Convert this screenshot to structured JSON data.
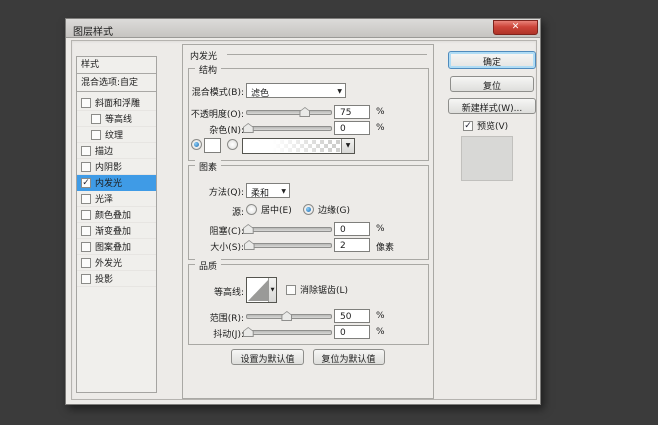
{
  "window": {
    "title": "图层样式",
    "close": "✕"
  },
  "sidebar": {
    "header": "样式",
    "blending": "混合选项:自定",
    "items": [
      {
        "label": "斜面和浮雕",
        "checked": false
      },
      {
        "label": "等高线",
        "checked": false
      },
      {
        "label": "纹理",
        "checked": false
      },
      {
        "label": "描边",
        "checked": false
      },
      {
        "label": "内阴影",
        "checked": false
      },
      {
        "label": "内发光",
        "checked": true,
        "selected": true
      },
      {
        "label": "光泽",
        "checked": false
      },
      {
        "label": "颜色叠加",
        "checked": false
      },
      {
        "label": "渐变叠加",
        "checked": false
      },
      {
        "label": "图案叠加",
        "checked": false
      },
      {
        "label": "外发光",
        "checked": false
      },
      {
        "label": "投影",
        "checked": false
      }
    ]
  },
  "panel": {
    "title": "内发光",
    "structure": {
      "legend": "结构",
      "blend_mode_label": "混合模式(B):",
      "blend_mode_value": "滤色",
      "opacity_label": "不透明度(O):",
      "opacity_value": "75",
      "opacity_unit": "%",
      "noise_label": "杂色(N):",
      "noise_value": "0",
      "noise_unit": "%"
    },
    "elements": {
      "legend": "图素",
      "technique_label": "方法(Q):",
      "technique_value": "柔和",
      "source_label": "源:",
      "source_center": "居中(E)",
      "source_edge": "边缘(G)",
      "choke_label": "阻塞(C):",
      "choke_value": "0",
      "choke_unit": "%",
      "size_label": "大小(S):",
      "size_value": "2",
      "size_unit": "像素"
    },
    "quality": {
      "legend": "品质",
      "contour_label": "等高线:",
      "antialias_label": "消除锯齿(L)",
      "range_label": "范围(R):",
      "range_value": "50",
      "range_unit": "%",
      "jitter_label": "抖动(J):",
      "jitter_value": "0",
      "jitter_unit": "%"
    },
    "footer": {
      "make_default": "设置为默认值",
      "reset_default": "复位为默认值"
    }
  },
  "actions": {
    "ok": "确定",
    "reset": "复位",
    "new_style": "新建样式(W)...",
    "preview": "预览(V)"
  },
  "sliders": {
    "opacity_pct": 68,
    "noise_pct": 2,
    "choke_pct": 2,
    "size_pct": 3,
    "range_pct": 47,
    "jitter_pct": 2
  },
  "colors": {
    "selection": "#3F9BE6",
    "close_button": "#C64237",
    "desktop": "#3B3B3B"
  }
}
